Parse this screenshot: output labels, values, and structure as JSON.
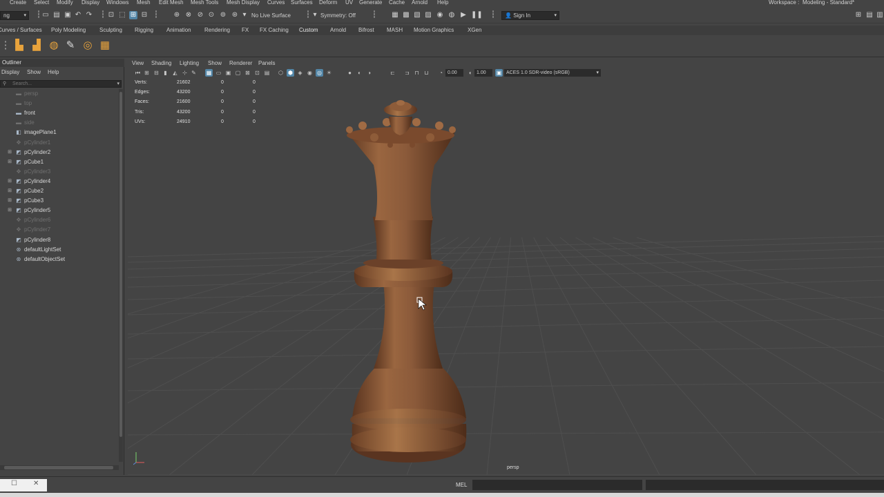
{
  "menubar": {
    "items": [
      "Create",
      "Select",
      "Modify",
      "Display",
      "Windows",
      "Mesh",
      "Edit Mesh",
      "Mesh Tools",
      "Mesh Display",
      "Curves",
      "Surfaces",
      "Deform",
      "UV",
      "Generate",
      "Cache",
      "Arnold",
      "Help"
    ],
    "workspace_label": "Workspace :",
    "workspace_value": "Modeling - Standard*"
  },
  "statusline": {
    "mode_value": "ng",
    "live_surface": "No Live Surface",
    "symmetry": "Symmetry: Off",
    "sign_in": "Sign In"
  },
  "shelf_tabs": [
    "Curves / Surfaces",
    "Poly Modeling",
    "Sculpting",
    "Rigging",
    "Animation",
    "Rendering",
    "FX",
    "FX Caching",
    "Custom",
    "Arnold",
    "Bifrost",
    "MASH",
    "Motion Graphics",
    "XGen"
  ],
  "outliner": {
    "title": "Outliner",
    "menu": [
      "Display",
      "Show",
      "Help"
    ],
    "search_placeholder": "Search...",
    "items": [
      {
        "label": "persp",
        "icon": "camera-icon",
        "expandable": false,
        "dim": true
      },
      {
        "label": "top",
        "icon": "camera-icon",
        "expandable": false,
        "dim": true
      },
      {
        "label": "front",
        "icon": "camera-icon",
        "expandable": false,
        "dim": false
      },
      {
        "label": "side",
        "icon": "camera-icon",
        "expandable": false,
        "dim": true
      },
      {
        "label": "imagePlane1",
        "icon": "image-plane-icon",
        "expandable": false,
        "dim": false
      },
      {
        "label": "pCylinder1",
        "icon": "transform-icon",
        "expandable": false,
        "dim": true
      },
      {
        "label": "pCylinder2",
        "icon": "mesh-icon",
        "expandable": true,
        "dim": false
      },
      {
        "label": "pCube1",
        "icon": "mesh-icon",
        "expandable": true,
        "dim": false
      },
      {
        "label": "pCylinder3",
        "icon": "transform-icon",
        "expandable": false,
        "dim": true
      },
      {
        "label": "pCylinder4",
        "icon": "mesh-icon",
        "expandable": true,
        "dim": false
      },
      {
        "label": "pCube2",
        "icon": "mesh-icon",
        "expandable": true,
        "dim": false
      },
      {
        "label": "pCube3",
        "icon": "mesh-icon",
        "expandable": true,
        "dim": false
      },
      {
        "label": "pCylinder5",
        "icon": "mesh-icon",
        "expandable": true,
        "dim": false
      },
      {
        "label": "pCylinder6",
        "icon": "transform-icon",
        "expandable": false,
        "dim": true
      },
      {
        "label": "pCylinder7",
        "icon": "transform-icon",
        "expandable": false,
        "dim": true
      },
      {
        "label": "pCylinder8",
        "icon": "mesh-icon",
        "expandable": false,
        "dim": false
      },
      {
        "label": "defaultLightSet",
        "icon": "set-icon",
        "expandable": false,
        "dim": false
      },
      {
        "label": "defaultObjectSet",
        "icon": "set-icon",
        "expandable": false,
        "dim": false
      }
    ]
  },
  "panel": {
    "menu": [
      "View",
      "Shading",
      "Lighting",
      "Show",
      "Renderer",
      "Panels"
    ],
    "near_value": "0.00",
    "gamma_value": "1.00",
    "color_space": "ACES 1.0 SDR-video (sRGB)"
  },
  "hud": [
    {
      "label": "Verts:",
      "total": "21602",
      "sel": "0",
      "comp": "0"
    },
    {
      "label": "Edges:",
      "total": "43200",
      "sel": "0",
      "comp": "0"
    },
    {
      "label": "Faces:",
      "total": "21600",
      "sel": "0",
      "comp": "0"
    },
    {
      "label": "Tris:",
      "total": "43200",
      "sel": "0",
      "comp": "0"
    },
    {
      "label": "UVs:",
      "total": "24910",
      "sel": "0",
      "comp": "0"
    }
  ],
  "viewport": {
    "camera": "persp",
    "model": "chess-queen",
    "model_color": "#8b5a3a"
  },
  "bottom": {
    "script_lang": "MEL"
  }
}
